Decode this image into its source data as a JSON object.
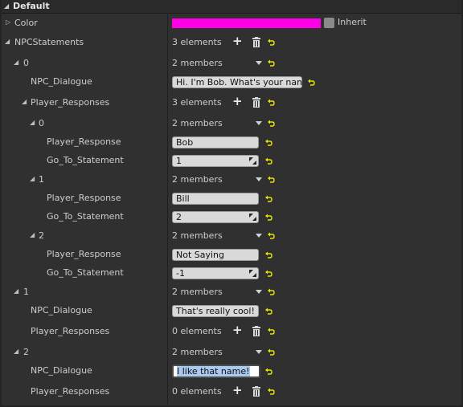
{
  "section": {
    "title": "Default"
  },
  "color_prop": {
    "name": "Color",
    "swatch": "#ff00e6",
    "inherit_label": "Inherit"
  },
  "npc": {
    "name": "NPCStatements",
    "count": "3 elements"
  },
  "s0": {
    "index": "0",
    "count": "2 members",
    "dialogue_name": "NPC_Dialogue",
    "dialogue": "Hi. I'm Bob. What's your name?",
    "responses_name": "Player_Responses",
    "responses_count": "3 elements",
    "r0": {
      "index": "0",
      "count": "2 members",
      "resp_name": "Player_Response",
      "resp": "Bob",
      "goto_name": "Go_To_Statement",
      "goto": "1"
    },
    "r1": {
      "index": "1",
      "count": "2 members",
      "resp_name": "Player_Response",
      "resp": "Bill",
      "goto_name": "Go_To_Statement",
      "goto": "2"
    },
    "r2": {
      "index": "2",
      "count": "2 members",
      "resp_name": "Player_Response",
      "resp": "Not Saying",
      "goto_name": "Go_To_Statement",
      "goto": "-1"
    }
  },
  "s1": {
    "index": "1",
    "count": "2 members",
    "dialogue_name": "NPC_Dialogue",
    "dialogue": "That's really cool!",
    "responses_name": "Player_Responses",
    "responses_count": "0 elements"
  },
  "s2": {
    "index": "2",
    "count": "2 members",
    "dialogue_name": "NPC_Dialogue",
    "dialogue": "I like that name!",
    "responses_name": "Player_Responses",
    "responses_count": "0 elements"
  }
}
